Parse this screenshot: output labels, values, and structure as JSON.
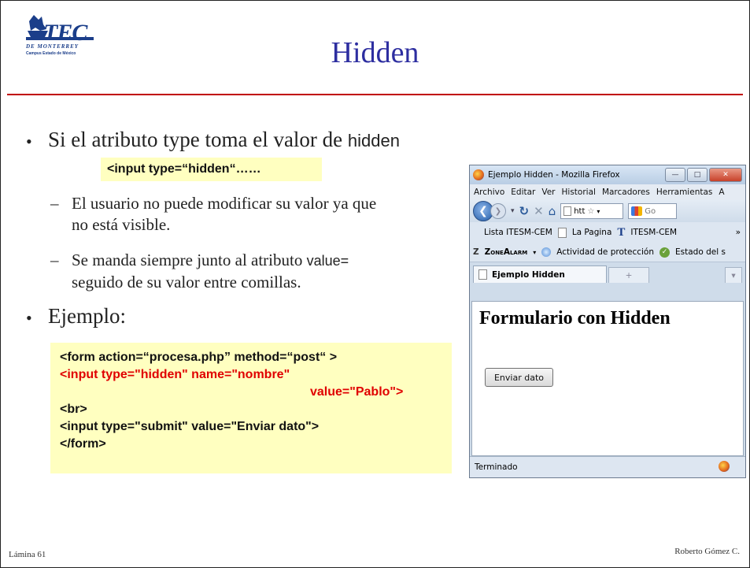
{
  "slide": {
    "title": "Hidden",
    "logo_text": "TEC",
    "logo_subtext": "DE MONTERREY",
    "logo_caption": "Campus Estado de México",
    "bullet1_serif": "Si el atributo type toma el valor de ",
    "bullet1_sans": "hidden",
    "inline_code": "<input type=“hidden“……",
    "sub1_line1": "El usuario no puede modificar su valor ya que",
    "sub1_line2": "no está visible.",
    "sub2_line1_serif": "Se manda siempre junto al atributo ",
    "sub2_line1_sans": "value=",
    "sub2_line2": "seguido de su valor entre comillas.",
    "bullet2": "Ejemplo:",
    "dash": "–",
    "bullet_mark": "•",
    "code_lines": {
      "l1": "<form  action=“procesa.php”   method=“post“ >",
      "l2": "<input type=\"hidden\" name=\"nombre\"",
      "l3": "value=\"Pablo\">",
      "l4": "<br>",
      "l5": "<input type=\"submit\" value=\"Enviar dato\">",
      "l6": "</form>"
    },
    "footer_left": "Lámina 61",
    "footer_right": "Roberto Gómez C."
  },
  "browser": {
    "window_title": "Ejemplo Hidden - Mozilla Firefox",
    "menu": [
      "Archivo",
      "Editar",
      "Ver",
      "Historial",
      "Marcadores",
      "Herramientas",
      "A"
    ],
    "url_text": "htt",
    "search_text": "Go",
    "bookmarks": [
      "Lista ITESM-CEM",
      "La Pagina",
      "ITESM-CEM"
    ],
    "bookmarks_more": "»",
    "zonealarm": "ZoneAlarm",
    "za_item1": "Actividad de protección",
    "za_item2": "Estado del s",
    "tab_label": "Ejemplo Hidden",
    "tab_add": "+",
    "page_heading": "Formulario con Hidden",
    "submit_label": "Enviar dato",
    "status_text": "Terminado"
  },
  "colors": {
    "title": "#2d2ea0",
    "rule": "#c00000",
    "code_bg": "#ffffc0",
    "code_red": "#e00000"
  }
}
